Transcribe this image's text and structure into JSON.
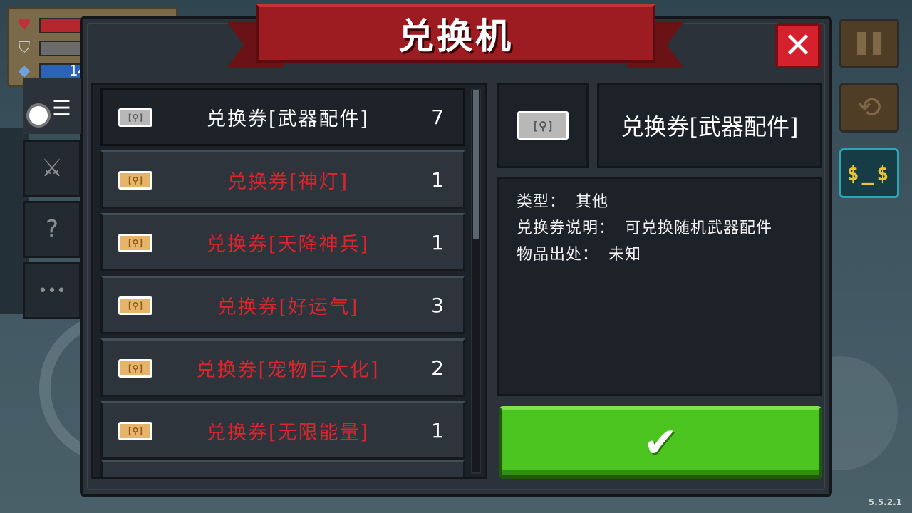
{
  "title": "兑换机",
  "close_label": "✕",
  "hud": {
    "mana_value": "14",
    "health_color": "#b6262d",
    "armor_color": "#6b6b6b",
    "mana_color": "#2d63b5"
  },
  "side_buttons": {
    "pause_icon": "pause-icon",
    "swap_icon": "swap-icon",
    "money_glyph": "$_$"
  },
  "version": "5.5.2.1",
  "left_tabs": [
    {
      "icon": "list-toggle-icon"
    },
    {
      "icon": "weapon-icon",
      "glyph": "⚔"
    },
    {
      "icon": "mystery-icon",
      "glyph": "?"
    },
    {
      "icon": "more-icon",
      "glyph": "•••"
    }
  ],
  "items": [
    {
      "name": "兑换券[武器配件]",
      "count": "7",
      "color": "white",
      "ticket": "grey",
      "selected": true
    },
    {
      "name": "兑换券[神灯]",
      "count": "1",
      "color": "red",
      "ticket": "gold",
      "selected": false
    },
    {
      "name": "兑换券[天降神兵]",
      "count": "1",
      "color": "red",
      "ticket": "gold",
      "selected": false
    },
    {
      "name": "兑换券[好运气]",
      "count": "3",
      "color": "red",
      "ticket": "gold",
      "selected": false
    },
    {
      "name": "兑换券[宠物巨大化]",
      "count": "2",
      "color": "red",
      "ticket": "gold",
      "selected": false
    },
    {
      "name": "兑换券[无限能量]",
      "count": "1",
      "color": "red",
      "ticket": "gold",
      "selected": false
    }
  ],
  "detail": {
    "name": "兑换券[武器配件]",
    "type_label": "类型：",
    "type_value": "其他",
    "desc_label": "兑换券说明：",
    "desc_value": "可兑换随机武器配件",
    "source_label": "物品出处：",
    "source_value": "未知"
  },
  "confirm_label": "✔"
}
